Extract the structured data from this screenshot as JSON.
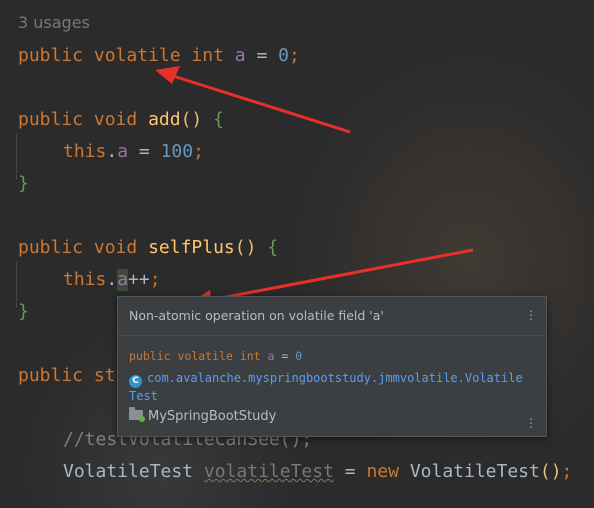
{
  "editor": {
    "usages_hint": "3 usages",
    "line1": {
      "kw_public": "public",
      "kw_volatile": "volatile",
      "kw_int": "int",
      "field": "a",
      "op": " = ",
      "value": "0",
      "semi": ";"
    },
    "add_sig": {
      "kw_public": "public",
      "kw_void": "void",
      "name": "add",
      "parens": "()",
      "brace": "{"
    },
    "add_body": {
      "this": "this",
      "dot": ".",
      "field": "a",
      "op": " = ",
      "value": "100",
      "semi": ";"
    },
    "close1": "}",
    "selfplus_sig": {
      "kw_public": "public",
      "kw_void": "void",
      "name": "selfPlus",
      "parens": "()",
      "brace": "{"
    },
    "selfplus_body": {
      "this": "this",
      "dot": ".",
      "field": "a",
      "op": "++",
      "semi": ";"
    },
    "close2": "}",
    "main_partial": {
      "kw_public": "public",
      "rest": "st"
    },
    "comment": "//testVolatileCanSee();",
    "last_line": {
      "type": "VolatileTest",
      "var": "volatileTest",
      "op": " = ",
      "kw_new": "new",
      "ctor": "VolatileTest",
      "parens": "()",
      "semi": ";"
    }
  },
  "popup": {
    "title": "Non-atomic operation on volatile field 'a'",
    "decl": {
      "kw_public": "public",
      "kw_volatile": "volatile",
      "kw_int": "int",
      "field": "a",
      "op": " = ",
      "value": "0"
    },
    "class_badge": "C",
    "class_path": "com.avalanche.myspringbootstudy.jmmvolatile.VolatileTest",
    "project": "MySpringBootStudy",
    "menu_glyph": "⋮"
  },
  "colors": {
    "arrow": "#e8302a",
    "keyword": "#cc7832",
    "number": "#6897bb",
    "field": "#9876aa",
    "function": "#ffc66d"
  }
}
